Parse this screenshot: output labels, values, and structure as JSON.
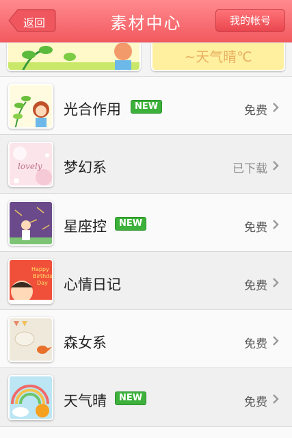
{
  "navbar": {
    "back_label": "返回",
    "title": "素材中心",
    "account_label": "我的帐号"
  },
  "banners": {
    "right_text": "~天气晴℃"
  },
  "items": [
    {
      "title": "光合作用",
      "is_new": true,
      "status": "免费",
      "downloaded": false,
      "thumb": "plant-girl"
    },
    {
      "title": "梦幻系",
      "is_new": false,
      "status": "已下载",
      "downloaded": true,
      "thumb": "dreamy-pink"
    },
    {
      "title": "星座控",
      "is_new": true,
      "status": "免费",
      "downloaded": false,
      "thumb": "purple-constellation"
    },
    {
      "title": "心情日记",
      "is_new": false,
      "status": "免费",
      "downloaded": false,
      "thumb": "happy-day"
    },
    {
      "title": "森女系",
      "is_new": false,
      "status": "免费",
      "downloaded": false,
      "thumb": "forest-bird"
    },
    {
      "title": "天气晴",
      "is_new": true,
      "status": "免费",
      "downloaded": false,
      "thumb": "rainbow-sun"
    }
  ],
  "new_badge_label": "NEW",
  "colors": {
    "navbar": "#f25a5f",
    "new_badge": "#3db13b",
    "background": "#f2f2f2"
  }
}
